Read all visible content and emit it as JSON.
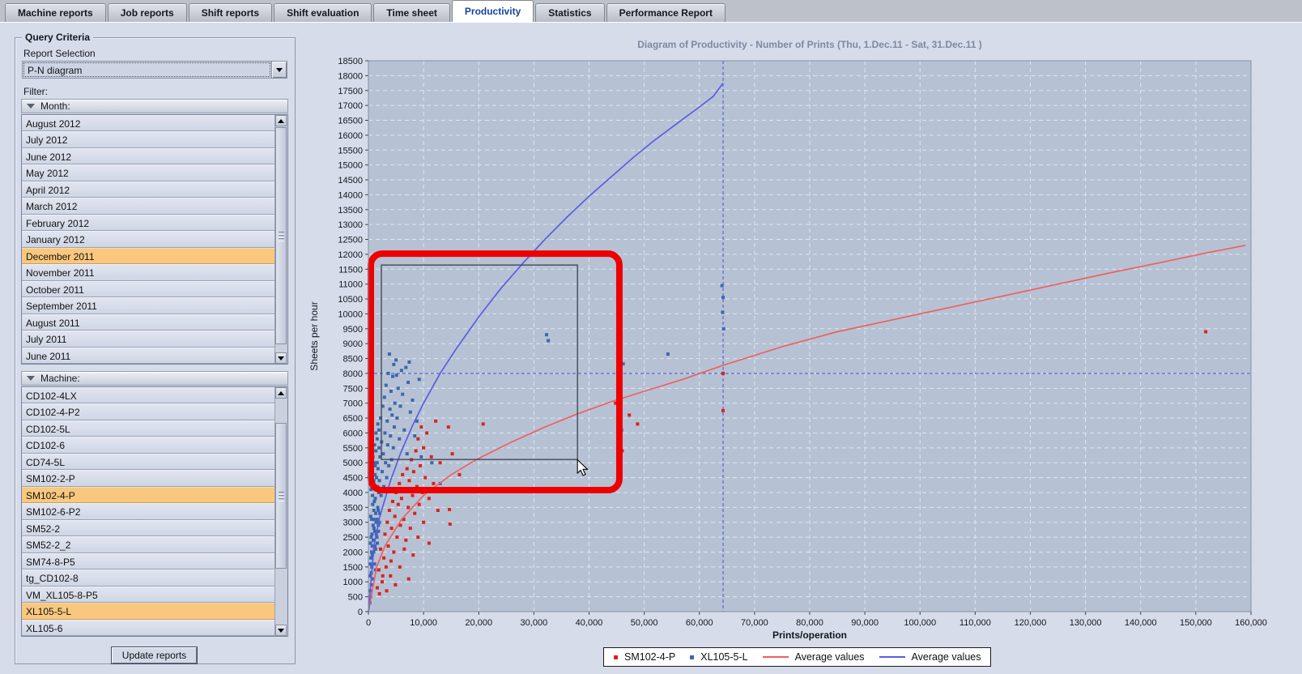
{
  "colors": {
    "selection_orange": "#f9c87e",
    "active_tab_text": "#15449e",
    "plot_bg": "#b6c2d4",
    "grid_line": "#dfe5ee",
    "crosshair_blue": "#4b52dd",
    "scatter_red": "#e01f1f",
    "scatter_blue": "#3c67ad",
    "avg_line_red": "#f05f5f",
    "avg_line_blue": "#5a5de2",
    "annotation_red": "#ee0000",
    "selection_rect": "#3c4250",
    "title_text": "#7e88a0"
  },
  "tabs": {
    "items": [
      {
        "label": "Machine reports",
        "active": false
      },
      {
        "label": "Job reports",
        "active": false
      },
      {
        "label": "Shift reports",
        "active": false
      },
      {
        "label": "Shift evaluation",
        "active": false
      },
      {
        "label": "Time sheet",
        "active": false
      },
      {
        "label": "Productivity",
        "active": true
      },
      {
        "label": "Statistics",
        "active": false
      },
      {
        "label": "Performance Report",
        "active": false
      }
    ]
  },
  "sidebar": {
    "group_title": "Query Criteria",
    "report_selection_label": "Report Selection",
    "report_selection_value": "P-N diagram",
    "filter_label": "Filter:",
    "month_header": "Month:",
    "months": [
      {
        "label": "August 2012",
        "selected": false
      },
      {
        "label": "July 2012",
        "selected": false
      },
      {
        "label": "June 2012",
        "selected": false
      },
      {
        "label": "May 2012",
        "selected": false
      },
      {
        "label": "April 2012",
        "selected": false
      },
      {
        "label": "March 2012",
        "selected": false
      },
      {
        "label": "February 2012",
        "selected": false
      },
      {
        "label": "January 2012",
        "selected": false
      },
      {
        "label": "December 2011",
        "selected": true
      },
      {
        "label": "November 2011",
        "selected": false
      },
      {
        "label": "October 2011",
        "selected": false
      },
      {
        "label": "September 2011",
        "selected": false
      },
      {
        "label": "August 2011",
        "selected": false
      },
      {
        "label": "July 2011",
        "selected": false
      },
      {
        "label": "June 2011",
        "selected": false
      }
    ],
    "machine_header": "Machine:",
    "machines": [
      {
        "label": "CD102-4LX",
        "selected": false
      },
      {
        "label": "CD102-4-P2",
        "selected": false
      },
      {
        "label": "CD102-5L",
        "selected": false
      },
      {
        "label": "CD102-6",
        "selected": false
      },
      {
        "label": "CD74-5L",
        "selected": false
      },
      {
        "label": "SM102-2-P",
        "selected": false
      },
      {
        "label": "SM102-4-P",
        "selected": true
      },
      {
        "label": "SM102-6-P2",
        "selected": false
      },
      {
        "label": "SM52-2",
        "selected": false
      },
      {
        "label": "SM52-2_2",
        "selected": false
      },
      {
        "label": "SM74-8-P5",
        "selected": false
      },
      {
        "label": "tg_CD102-8",
        "selected": false
      },
      {
        "label": "VM_XL105-8-P5",
        "selected": false
      },
      {
        "label": "XL105-5-L",
        "selected": true
      },
      {
        "label": "XL105-6",
        "selected": false
      }
    ],
    "update_button_label": "Update reports"
  },
  "chart_data": {
    "type": "scatter",
    "title": "Diagram of Productivity - Number of Prints   (Thu, 1.Dec.11  - Sat, 31.Dec.11 )",
    "xlabel": "Prints/operation",
    "ylabel": "Sheets per hour",
    "xlim": [
      0,
      160000
    ],
    "xstep": 10000,
    "ylim": [
      0,
      18500
    ],
    "ystep": 500,
    "grid": true,
    "legend_position": "bottom",
    "crosshair": {
      "x": 64300,
      "y": 8000
    },
    "annotations": {
      "selection_rect": {
        "x1": 2350,
        "y1": 5110,
        "x2": 37900,
        "y2": 11640
      },
      "highlight_rect": {
        "x1": 440,
        "y1": 4080,
        "x2": 45500,
        "y2": 12020,
        "stroke_width": 8,
        "radius": 14
      },
      "cursor": {
        "x": 37900,
        "y": 5100
      }
    },
    "series": [
      {
        "name": "SM102-4-P",
        "kind": "scatter",
        "colorkey": "scatter_red",
        "points": [
          [
            1600,
            800
          ],
          [
            1900,
            1400
          ],
          [
            2200,
            2100
          ],
          [
            2500,
            1000
          ],
          [
            2800,
            1800
          ],
          [
            3000,
            2600
          ],
          [
            3200,
            1500
          ],
          [
            3400,
            3000
          ],
          [
            3600,
            2200
          ],
          [
            3800,
            3400
          ],
          [
            4000,
            1200
          ],
          [
            4200,
            2800
          ],
          [
            4400,
            3700
          ],
          [
            4600,
            2000
          ],
          [
            4800,
            3200
          ],
          [
            5000,
            4000
          ],
          [
            5200,
            2500
          ],
          [
            5400,
            3600
          ],
          [
            5600,
            4300
          ],
          [
            5800,
            2900
          ],
          [
            6000,
            3800
          ],
          [
            6200,
            4600
          ],
          [
            6400,
            3100
          ],
          [
            6600,
            4100
          ],
          [
            6800,
            2400
          ],
          [
            7000,
            4800
          ],
          [
            7200,
            3500
          ],
          [
            7400,
            4400
          ],
          [
            7600,
            2800
          ],
          [
            7800,
            5100
          ],
          [
            8000,
            3900
          ],
          [
            8200,
            4700
          ],
          [
            8400,
            3300
          ],
          [
            8600,
            5400
          ],
          [
            8800,
            4200
          ],
          [
            9000,
            5800
          ],
          [
            9200,
            3600
          ],
          [
            9400,
            4900
          ],
          [
            9600,
            6200
          ],
          [
            9800,
            4000
          ],
          [
            10000,
            5500
          ],
          [
            10300,
            4500
          ],
          [
            10600,
            6000
          ],
          [
            11000,
            3800
          ],
          [
            11400,
            5200
          ],
          [
            11800,
            4300
          ],
          [
            12200,
            6400
          ],
          [
            12600,
            3400
          ],
          [
            13000,
            5000
          ],
          [
            2000,
            600
          ],
          [
            2600,
            1200
          ],
          [
            3300,
            700
          ],
          [
            4100,
            1700
          ],
          [
            4900,
            900
          ],
          [
            5700,
            1500
          ],
          [
            6500,
            2100
          ],
          [
            7300,
            1100
          ],
          [
            8100,
            1900
          ],
          [
            9000,
            2500
          ],
          [
            10000,
            3000
          ],
          [
            11000,
            2300
          ],
          [
            14500,
            6200
          ],
          [
            14700,
            3430
          ],
          [
            14800,
            2940
          ],
          [
            15200,
            5300
          ],
          [
            16500,
            4600
          ],
          [
            20800,
            6300
          ],
          [
            44800,
            7000
          ],
          [
            46000,
            5400
          ],
          [
            47300,
            6600
          ],
          [
            48800,
            6300
          ],
          [
            64300,
            8000
          ],
          [
            64300,
            6750
          ],
          [
            151800,
            9400
          ]
        ]
      },
      {
        "name": "XL105-5-L",
        "kind": "scatter",
        "colorkey": "scatter_blue",
        "points": [
          [
            300,
            700
          ],
          [
            350,
            1200
          ],
          [
            400,
            500
          ],
          [
            450,
            1800
          ],
          [
            500,
            2500
          ],
          [
            550,
            900
          ],
          [
            600,
            3100
          ],
          [
            620,
            1500
          ],
          [
            700,
            2200
          ],
          [
            750,
            3900
          ],
          [
            800,
            1100
          ],
          [
            850,
            2900
          ],
          [
            900,
            4300
          ],
          [
            950,
            2000
          ],
          [
            1000,
            3400
          ],
          [
            1050,
            5000
          ],
          [
            1100,
            1600
          ],
          [
            1150,
            2700
          ],
          [
            1200,
            4600
          ],
          [
            1250,
            3800
          ],
          [
            1300,
            2100
          ],
          [
            1350,
            5400
          ],
          [
            1400,
            3000
          ],
          [
            1500,
            4100
          ],
          [
            1550,
            2500
          ],
          [
            1600,
            5800
          ],
          [
            1700,
            3500
          ],
          [
            1750,
            4800
          ],
          [
            1800,
            2900
          ],
          [
            1900,
            6100
          ],
          [
            2000,
            4400
          ],
          [
            2050,
            3300
          ],
          [
            2100,
            5200
          ],
          [
            2200,
            6500
          ],
          [
            2300,
            3900
          ],
          [
            2400,
            5700
          ],
          [
            2500,
            4700
          ],
          [
            2600,
            6900
          ],
          [
            2700,
            5300
          ],
          [
            2800,
            4200
          ],
          [
            2900,
            7200
          ],
          [
            3000,
            6000
          ],
          [
            3100,
            5000
          ],
          [
            3200,
            7600
          ],
          [
            3300,
            4500
          ],
          [
            3400,
            6400
          ],
          [
            3500,
            5600
          ],
          [
            3600,
            8000
          ],
          [
            3700,
            4900
          ],
          [
            3800,
            8650
          ],
          [
            3900,
            6800
          ],
          [
            4000,
            5900
          ],
          [
            4100,
            7400
          ],
          [
            4200,
            5100
          ],
          [
            4300,
            6600
          ],
          [
            4400,
            7900
          ],
          [
            4500,
            5500
          ],
          [
            4600,
            8300
          ],
          [
            4700,
            6200
          ],
          [
            4800,
            7000
          ],
          [
            5000,
            8450
          ],
          [
            5100,
            7940
          ],
          [
            5200,
            6500
          ],
          [
            5400,
            7500
          ],
          [
            5600,
            5800
          ],
          [
            5800,
            6900
          ],
          [
            6000,
            8100
          ],
          [
            6200,
            7300
          ],
          [
            6500,
            6100
          ],
          [
            6800,
            8200
          ],
          [
            7000,
            5300
          ],
          [
            7200,
            7700
          ],
          [
            7400,
            8380
          ],
          [
            7600,
            6700
          ],
          [
            8000,
            7100
          ],
          [
            8400,
            5900
          ],
          [
            8800,
            6400
          ],
          [
            9200,
            7800
          ],
          [
            9600,
            5200
          ],
          [
            250,
            300
          ],
          [
            320,
            1600
          ],
          [
            380,
            2300
          ],
          [
            420,
            3200
          ],
          [
            480,
            4100
          ],
          [
            520,
            1300
          ],
          [
            580,
            2000
          ],
          [
            640,
            2600
          ],
          [
            680,
            4700
          ],
          [
            720,
            1900
          ],
          [
            780,
            3600
          ],
          [
            820,
            5200
          ],
          [
            880,
            2400
          ],
          [
            920,
            3100
          ],
          [
            980,
            4400
          ],
          [
            1020,
            2800
          ],
          [
            1080,
            3700
          ],
          [
            1120,
            5600
          ],
          [
            1180,
            2200
          ],
          [
            1240,
            4900
          ],
          [
            1280,
            1400
          ],
          [
            1320,
            3300
          ],
          [
            1380,
            6000
          ],
          [
            1420,
            2600
          ],
          [
            1480,
            4500
          ],
          [
            1520,
            3100
          ],
          [
            1580,
            5000
          ],
          [
            1620,
            2300
          ],
          [
            1680,
            4200
          ],
          [
            1720,
            6300
          ],
          [
            1780,
            3400
          ],
          [
            1820,
            2700
          ],
          [
            1880,
            4000
          ],
          [
            1920,
            5500
          ],
          [
            1980,
            3000
          ],
          [
            11500,
            5000
          ],
          [
            13000,
            4300
          ],
          [
            32300,
            9300
          ],
          [
            32600,
            9100
          ],
          [
            45900,
            6100
          ],
          [
            46200,
            8320
          ],
          [
            54300,
            8650
          ],
          [
            64100,
            10950
          ],
          [
            64300,
            10550
          ],
          [
            64200,
            10050
          ],
          [
            64400,
            9500
          ]
        ]
      },
      {
        "name": "Average values",
        "kind": "line",
        "colorkey": "avg_line_red",
        "points": [
          [
            0,
            0
          ],
          [
            1500,
            1500
          ],
          [
            3000,
            2200
          ],
          [
            6000,
            3100
          ],
          [
            10000,
            3900
          ],
          [
            15000,
            4600
          ],
          [
            20000,
            5150
          ],
          [
            26000,
            5700
          ],
          [
            32000,
            6200
          ],
          [
            38000,
            6650
          ],
          [
            44000,
            7050
          ],
          [
            50000,
            7400
          ],
          [
            57000,
            7800
          ],
          [
            64300,
            8270
          ],
          [
            75000,
            8900
          ],
          [
            85000,
            9400
          ],
          [
            95000,
            9800
          ],
          [
            105000,
            10200
          ],
          [
            115000,
            10600
          ],
          [
            125000,
            11000
          ],
          [
            135000,
            11400
          ],
          [
            143000,
            11700
          ],
          [
            152000,
            12050
          ],
          [
            159000,
            12300
          ]
        ]
      },
      {
        "name": "Average values",
        "kind": "line",
        "colorkey": "avg_line_blue",
        "points": [
          [
            0,
            0
          ],
          [
            1000,
            2200
          ],
          [
            2000,
            3150
          ],
          [
            4000,
            4400
          ],
          [
            6000,
            5400
          ],
          [
            8000,
            6250
          ],
          [
            10000,
            7000
          ],
          [
            13000,
            8000
          ],
          [
            16000,
            8850
          ],
          [
            20000,
            9900
          ],
          [
            24000,
            10850
          ],
          [
            28000,
            11700
          ],
          [
            32000,
            12500
          ],
          [
            36000,
            13250
          ],
          [
            40000,
            13950
          ],
          [
            44000,
            14600
          ],
          [
            48000,
            15250
          ],
          [
            52000,
            15850
          ],
          [
            56000,
            16400
          ],
          [
            60000,
            16950
          ],
          [
            62500,
            17300
          ],
          [
            64300,
            17750
          ]
        ]
      }
    ]
  }
}
